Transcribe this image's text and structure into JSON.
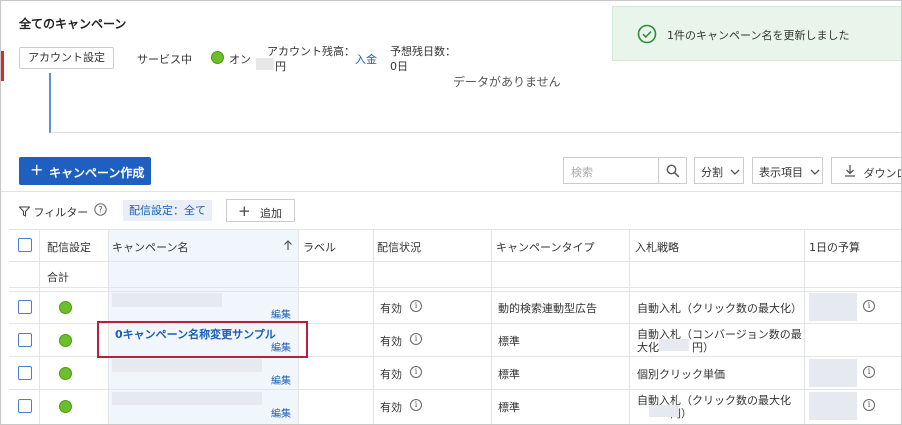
{
  "header": {
    "title": "全てのキャンペーン",
    "account_settings": "アカウント設定",
    "service_label": "サービス中",
    "service_status": "オン",
    "balance_label": "アカウント残高：",
    "balance_unit": "円",
    "deposit": "入金",
    "days_label": "予想残日数：",
    "days_value": "0日"
  },
  "toast": {
    "message": "1件のキャンペーン名を更新しました"
  },
  "empty": {
    "message": "データがありません"
  },
  "toolbar": {
    "create": "キャンペーン作成",
    "search_placeholder": "検索",
    "segment": "分割",
    "columns": "表示項目",
    "download": "ダウンロ"
  },
  "filter": {
    "label": "フィルター",
    "chip": "配信設定：全て",
    "add": "追加"
  },
  "table": {
    "headers": {
      "delivery": "配信設定",
      "name": "キャンペーン名",
      "label": "ラベル",
      "status": "配信状況",
      "type": "キャンペーンタイプ",
      "bidding": "入札戦略",
      "budget": "1日の予算"
    },
    "total_label": "合計",
    "edit_label": "編集",
    "rows": [
      {
        "name": "",
        "status": "有効",
        "type": "動的検索連動型広告",
        "bidding": "自動入札（クリック数の最大化）",
        "bidding2": ""
      },
      {
        "name": "0キャンペーン名称変更サンプル",
        "status": "有効",
        "type": "標準",
        "bidding": "自動入札（コンバージョン数の最",
        "bidding2": "大化　　　円）"
      },
      {
        "name": "",
        "status": "有効",
        "type": "標準",
        "bidding": "個別クリック単価",
        "bidding2": ""
      },
      {
        "name": "",
        "status": "有効",
        "type": "標準",
        "bidding": "自動入札（クリック数の最大化",
        "bidding2": "　　　円）"
      }
    ]
  },
  "colors": {
    "primary": "#1f5fbf",
    "link": "#1a5fb4",
    "on": "#6cbf2a",
    "highlight": "#b3213d",
    "toast_bg": "#e9f5ea"
  }
}
